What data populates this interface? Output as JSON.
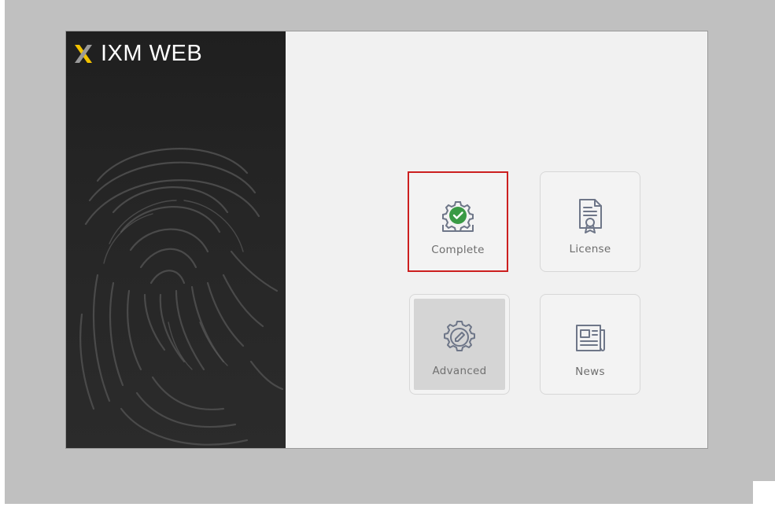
{
  "app": {
    "title": "IXM WEB"
  },
  "tiles": {
    "complete": {
      "label": "Complete",
      "icon": "gear-check-icon",
      "state": "selected"
    },
    "license": {
      "label": "License",
      "icon": "certificate-document-icon"
    },
    "advanced": {
      "label": "Advanced",
      "icon": "gear-pencil-icon",
      "state": "disabled"
    },
    "news": {
      "label": "News",
      "icon": "newspaper-icon"
    }
  },
  "colors": {
    "accent_check": "#3a9a45",
    "selection_border": "#cc1f1f",
    "logo_yellow": "#f2c200",
    "icon_stroke": "#6e7688",
    "sidebar_dark": "#262626"
  }
}
